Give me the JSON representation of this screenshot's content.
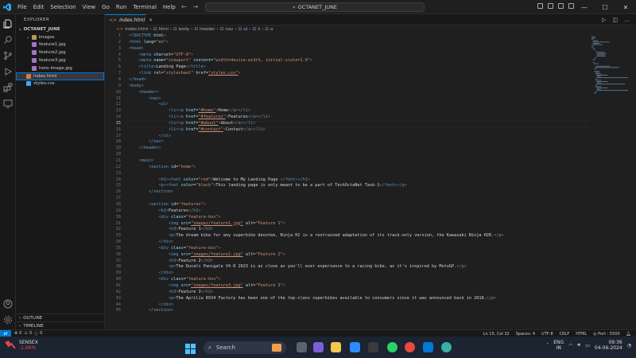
{
  "menu": [
    "File",
    "Edit",
    "Selection",
    "View",
    "Go",
    "Run",
    "Terminal",
    "Help"
  ],
  "command_center": "OCTANET_JUNE",
  "sidebar": {
    "title": "EXPLORER",
    "root": "OCTANET_JUNE",
    "items": [
      {
        "label": "images",
        "kind": "folder",
        "depth": 1
      },
      {
        "label": "feature1.jpg",
        "kind": "image",
        "depth": 2
      },
      {
        "label": "feature2.jpg",
        "kind": "image",
        "depth": 2
      },
      {
        "label": "feature3.jpg",
        "kind": "image",
        "depth": 2
      },
      {
        "label": "hero-image.jpg",
        "kind": "image",
        "depth": 2
      },
      {
        "label": "index.html",
        "kind": "html",
        "depth": 1,
        "selected": true
      },
      {
        "label": "styles.css",
        "kind": "css",
        "depth": 1
      }
    ],
    "outline": "OUTLINE",
    "timeline": "TIMELINE"
  },
  "tab": {
    "label": "index.html"
  },
  "breadcrumb": [
    "index.html",
    "html",
    "body",
    "header",
    "nav",
    "ul",
    "li",
    "a"
  ],
  "code_lines": [
    "<!DOCTYPE html>",
    "<html lang=\"en\">",
    "<head>",
    "    <meta charset=\"UTF-8\">",
    "    <meta name=\"viewport\" content=\"width=device-width, initial-scale=1.0\">",
    "    <title>Landing Page</title>",
    "    <link rel=\"stylesheet\" href=\"styles.css\">",
    "</head>",
    "<body>",
    "    <header>",
    "        <nav>",
    "            <ul>",
    "                <li><a href=\"#home\">Home</a></li>",
    "                <li><a href=\"#features\">Features</a></li>",
    "                <li><a href=\"#about\">About</a></li>",
    "                <li><a href=\"#contact\">Contact</a></li>",
    "            </ul>",
    "        </nav>",
    "    </header>",
    "",
    "    <main>",
    "        <section id=\"home\">",
    "",
    "            <h1><font color=\"red\">Welcome to My Landing Page </font></h1>",
    "            <p><font color=\"black\">This landing page is only meant to be a part of TechOctaNet Task-1</font></p>",
    "        </section>",
    "",
    "        <section id=\"features\">",
    "            <h2>Features</h2>",
    "            <div class=\"feature-box\">",
    "                <img src=\"images/feature1.jpg\" alt=\"Feature 1\">",
    "                <h3>Feature 1</h3>",
    "                <p>The dream bike for any superbike devotee, Ninja H2 is a restrained adaptation of its track-only version, the Kawasaki Ninja H2R.</p>",
    "            </div>",
    "            <div class=\"feature-box\">",
    "                <img src=\"images/feature2.jpg\" alt=\"Feature 2\">",
    "                <h3>Feature 2</h3>",
    "                <p>The Ducati Panigale V4 R 2023 is as close as you'll ever experience to a racing bike, as it's inspired by MotoGP.</p>",
    "            </div>",
    "            <div class=\"feature-box\">",
    "                <img src=\"images/feature3.jpg\" alt=\"Feature 3\">",
    "                <h3>Feature 3</h3>",
    "                <p>The Aprilia RSV4 Factory has been one of the top-class superbikes available to consumers since it was announced back in 2018.</p>",
    "            </div>",
    "        </section>"
  ],
  "current_line": 15,
  "status": {
    "left_errors": "0",
    "left_warnings": "0",
    "left_info": "0",
    "position": "Ln 15, Col 32",
    "spaces": "Spaces: 4",
    "encoding": "UTF-8",
    "eol": "CRLF",
    "language": "HTML",
    "port": "Port : 5500"
  },
  "taskbar": {
    "weather_title": "SENSEX",
    "weather_value": "-1.66%",
    "search_label": "Search",
    "lang_top": "ENG",
    "lang_bottom": "IN",
    "time": "09:36",
    "date": "04-06-2024"
  },
  "colors": {
    "accent": "#0078d4",
    "tag": "#569cd6",
    "attr": "#9cdcfe",
    "string": "#ce9178"
  }
}
